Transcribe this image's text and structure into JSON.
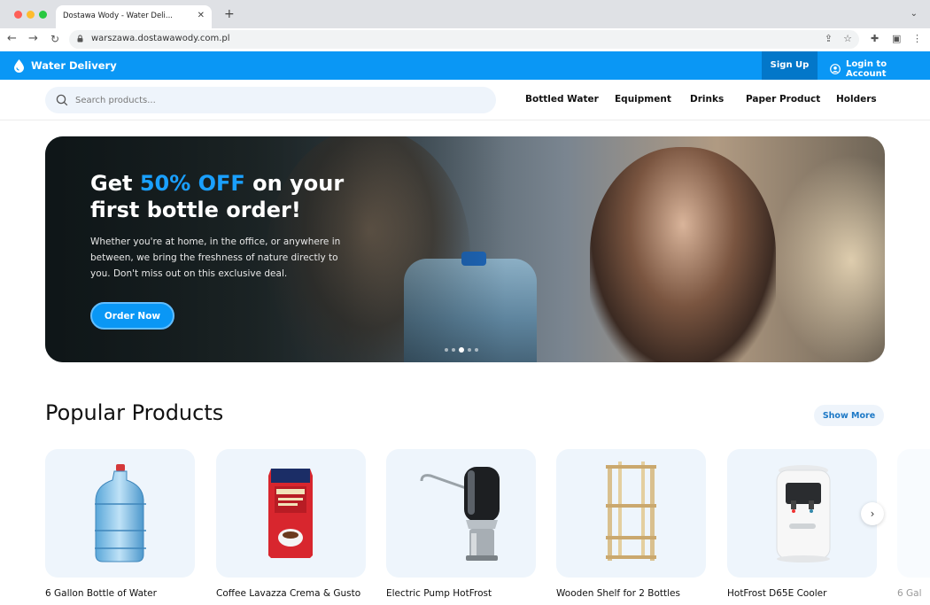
{
  "browser": {
    "tab_title": "Dostawa Wody - Water Deli...",
    "url": "warszawa.dostawawody.com.pl"
  },
  "header": {
    "logo_text": "Water Delivery",
    "signup_label": "Sign Up",
    "login_label": "Login to Account",
    "accent_color": "#0a97f5"
  },
  "search": {
    "placeholder": "Search products..."
  },
  "categories": [
    "Bottled Water",
    "Equipment",
    "Drinks",
    "Paper Product",
    "Holders"
  ],
  "hero": {
    "title_prefix": "Get ",
    "title_highlight": "50% OFF",
    "title_suffix": " on your first bottle order!",
    "text": "Whether you're at home, in the office, or anywhere in between, we bring the freshness of nature directly to you. Don't miss out on this exclusive deal.",
    "cta_label": "Order Now",
    "slides": 5,
    "active_slide": 3
  },
  "products": {
    "title": "Popular Products",
    "show_more_label": "Show More",
    "items": [
      {
        "name": "6 Gallon Bottle of Water",
        "icon": "water-bottle-icon"
      },
      {
        "name": "Coffee Lavazza Crema & Gusto",
        "icon": "coffee-pack-icon"
      },
      {
        "name": "Electric Pump HotFrost",
        "icon": "pump-icon"
      },
      {
        "name": "Wooden Shelf for 2 Bottles",
        "icon": "shelf-icon"
      },
      {
        "name": "HotFrost D65E Cooler",
        "icon": "cooler-icon"
      }
    ],
    "partial_item_label": "6 Gal"
  }
}
